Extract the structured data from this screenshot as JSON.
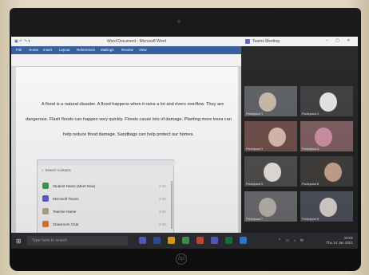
{
  "word": {
    "window_title": "Word Document - Microsoft Word",
    "ribbon_tabs": [
      "File",
      "Home",
      "Insert",
      "Layout",
      "References",
      "Mailings",
      "Review",
      "View"
    ],
    "paragraph": "A flood is a natural disaster. A flood happens when it rains a lot and rivers overflow. They are dangerous. Flash floods can happen very quickly. Floods cause lots of damage. Planting more trees can help reduce flood damage. Sandbags can help protect our homes."
  },
  "chat_popup": {
    "search_placeholder": "Search contacts",
    "rows": [
      {
        "label": "Student Name (Meet Now)",
        "color": "#3f9d4f",
        "meta": "2:15"
      },
      {
        "label": "Microsoft Teams",
        "color": "#5b5fc7",
        "meta": "2:15"
      },
      {
        "label": "Teacher Name",
        "color": "#b8a58c",
        "meta": "2:15"
      },
      {
        "label": "Classroom Chat",
        "color": "#e07b39",
        "meta": "2:15"
      }
    ]
  },
  "teams": {
    "window_title": "Teams Meeting",
    "tiles": [
      {
        "name": "Participant 1",
        "bg": "#5a5d63",
        "blob": "#c9b8a6"
      },
      {
        "name": "Participant 2",
        "bg": "#3b3b3e",
        "blob": "#e9e6e2"
      },
      {
        "name": "Participant 3",
        "bg": "#6c4a45",
        "blob": "#d7b9ad"
      },
      {
        "name": "Participant 4",
        "bg": "#7c5a5f",
        "blob": "#cc8ea4"
      },
      {
        "name": "Participant 5",
        "bg": "#4d4a4a",
        "blob": "#e7e2dc"
      },
      {
        "name": "Participant 6",
        "bg": "#3d3a38",
        "blob": "#c8a28d"
      },
      {
        "name": "Participant 7",
        "bg": "#6a6a6e",
        "blob": "#b9b3ad"
      },
      {
        "name": "Participant 8",
        "bg": "#4a4f5a",
        "blob": "#dcd4cc"
      }
    ]
  },
  "taskbar": {
    "search_placeholder": "Type here to search",
    "time": "10:01",
    "date": "Thu 14 Jan 2021",
    "apps": [
      "#5b5fc7",
      "#2b579a",
      "#e7a91c",
      "#3f9d4f",
      "#d04b3b",
      "#5b5fc7",
      "#217346",
      "#2c7ee7"
    ]
  },
  "brand": {
    "logo": "hp"
  }
}
